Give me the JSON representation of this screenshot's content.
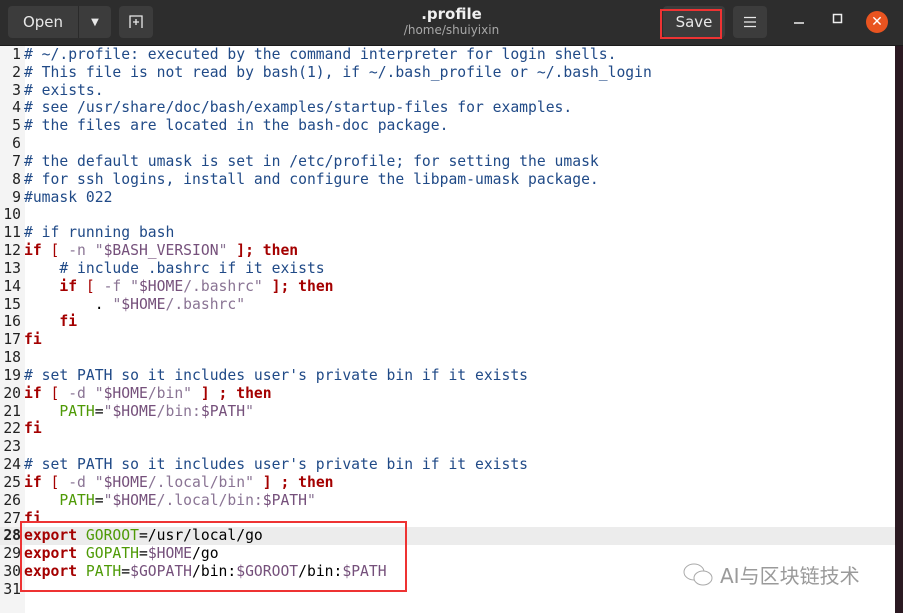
{
  "toolbar": {
    "open_label": "Open",
    "save_label": "Save"
  },
  "window": {
    "title": ".profile",
    "subtitle": "/home/shuiyixin"
  },
  "icons": {
    "dropdown": "chevron-down-icon",
    "new_tab": "new-tab-icon",
    "menu": "hamburger-menu-icon",
    "minimize": "minimize-icon",
    "maximize": "maximize-icon",
    "close": "close-icon"
  },
  "colors": {
    "comment": "#204a87",
    "keyword": "#a40000",
    "string": "#8a7494",
    "variable": "#75507b",
    "identifier": "#4e9a06",
    "close_button": "#e95420",
    "annotation": "#ee3333"
  },
  "current_line": 28,
  "lines": [
    [
      [
        "c",
        "# ~/.profile: executed by the command interpreter for login shells."
      ]
    ],
    [
      [
        "c",
        "# This file is not read by bash(1), if ~/.bash_profile or ~/.bash_login"
      ]
    ],
    [
      [
        "c",
        "# exists."
      ]
    ],
    [
      [
        "c",
        "# see /usr/share/doc/bash/examples/startup-files for examples."
      ]
    ],
    [
      [
        "c",
        "# the files are located in the bash-doc package."
      ]
    ],
    [],
    [
      [
        "c",
        "# the default umask is set in /etc/profile; for setting the umask"
      ]
    ],
    [
      [
        "c",
        "# for ssh logins, install and configure the libpam-umask package."
      ]
    ],
    [
      [
        "c",
        "#umask 022"
      ]
    ],
    [],
    [
      [
        "c",
        "# if running bash"
      ]
    ],
    [
      [
        "k",
        "if"
      ],
      [
        "",
        " "
      ],
      [
        "p",
        "["
      ],
      [
        "",
        ""
      ],
      [
        "s",
        " -n "
      ],
      [
        "s",
        "\""
      ],
      [
        "v",
        "$BASH_VERSION"
      ],
      [
        "s",
        "\""
      ],
      [
        "",
        ""
      ],
      [
        "k",
        " ];"
      ],
      [
        "",
        ""
      ],
      [
        "k",
        " then"
      ]
    ],
    [
      [
        "",
        "    "
      ],
      [
        "c",
        "# include .bashrc if it exists"
      ]
    ],
    [
      [
        "",
        "    "
      ],
      [
        "k",
        "if"
      ],
      [
        "",
        ""
      ],
      [
        "p",
        " ["
      ],
      [
        "s",
        " -f "
      ],
      [
        "s",
        "\""
      ],
      [
        "v",
        "$HOME"
      ],
      [
        "s",
        "/.bashrc\""
      ],
      [
        "k",
        " ];"
      ],
      [
        "k",
        " then"
      ]
    ],
    [
      [
        "",
        "        . "
      ],
      [
        "s",
        "\""
      ],
      [
        "v",
        "$HOME"
      ],
      [
        "s",
        "/.bashrc\""
      ]
    ],
    [
      [
        "",
        "    "
      ],
      [
        "k",
        "fi"
      ]
    ],
    [
      [
        "k",
        "fi"
      ]
    ],
    [],
    [
      [
        "c",
        "# set PATH so it includes user's private bin if it exists"
      ]
    ],
    [
      [
        "k",
        "if"
      ],
      [
        "p",
        " ["
      ],
      [
        "s",
        " -d "
      ],
      [
        "s",
        "\""
      ],
      [
        "v",
        "$HOME"
      ],
      [
        "s",
        "/bin\""
      ],
      [
        "k",
        " ] ;"
      ],
      [
        "k",
        " then"
      ]
    ],
    [
      [
        "",
        "    "
      ],
      [
        "g",
        "PATH"
      ],
      [
        "",
        "="
      ],
      [
        "s",
        "\""
      ],
      [
        "v",
        "$HOME"
      ],
      [
        "s",
        "/bin:"
      ],
      [
        "v",
        "$PATH"
      ],
      [
        "s",
        "\""
      ]
    ],
    [
      [
        "k",
        "fi"
      ]
    ],
    [],
    [
      [
        "c",
        "# set PATH so it includes user's private bin if it exists"
      ]
    ],
    [
      [
        "k",
        "if"
      ],
      [
        "p",
        " ["
      ],
      [
        "s",
        " -d "
      ],
      [
        "s",
        "\""
      ],
      [
        "v",
        "$HOME"
      ],
      [
        "s",
        "/.local/bin\""
      ],
      [
        "k",
        " ] ;"
      ],
      [
        "k",
        " then"
      ]
    ],
    [
      [
        "",
        "    "
      ],
      [
        "g",
        "PATH"
      ],
      [
        "",
        "="
      ],
      [
        "s",
        "\""
      ],
      [
        "v",
        "$HOME"
      ],
      [
        "s",
        "/.local/bin:"
      ],
      [
        "v",
        "$PATH"
      ],
      [
        "s",
        "\""
      ]
    ],
    [
      [
        "k",
        "fi"
      ]
    ],
    [
      [
        "k",
        "export"
      ],
      [
        "",
        " "
      ],
      [
        "g",
        "GOROOT"
      ],
      [
        "",
        "=/usr/local/go"
      ]
    ],
    [
      [
        "k",
        "export"
      ],
      [
        "",
        " "
      ],
      [
        "g",
        "GOPATH"
      ],
      [
        "",
        "="
      ],
      [
        "v",
        "$HOME"
      ],
      [
        "",
        "/go"
      ]
    ],
    [
      [
        "k",
        "export"
      ],
      [
        "",
        " "
      ],
      [
        "g",
        "PATH"
      ],
      [
        "",
        "="
      ],
      [
        "v",
        "$GOPATH"
      ],
      [
        "",
        "/bin:"
      ],
      [
        "v",
        "$GOROOT"
      ],
      [
        "",
        "/bin:"
      ],
      [
        "v",
        "$PATH"
      ]
    ],
    []
  ],
  "watermark": "AI与区块链技术"
}
